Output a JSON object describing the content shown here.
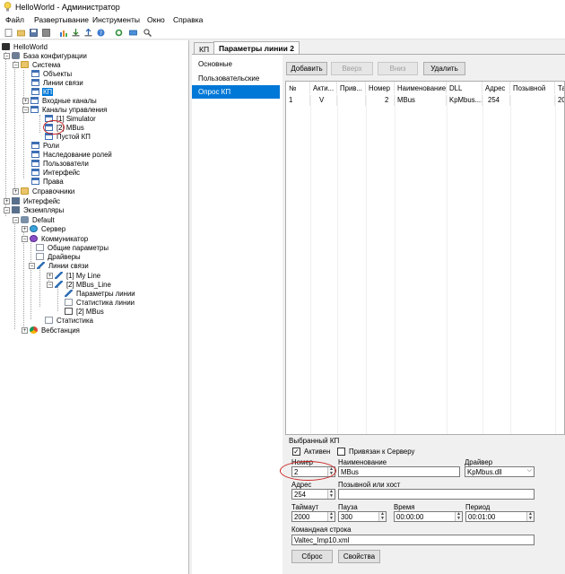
{
  "window": {
    "title": "HelloWorld - Администратор"
  },
  "menu": [
    "Файл",
    "Развертывание",
    "Инструменты",
    "Окно",
    "Справка"
  ],
  "toolbar": {
    "icons": [
      "new-icon",
      "open-icon",
      "save-icon",
      "save-all-icon",
      "charts-icon",
      "import-icon",
      "export-icon",
      "help-icon",
      "settings-icon",
      "deploy-icon",
      "search-icon"
    ]
  },
  "tree": {
    "nodes": [
      {
        "label": "HelloWorld",
        "icon": "project-icon"
      },
      {
        "label": "База конфигурации",
        "icon": "database-icon"
      },
      {
        "label": "Система",
        "icon": "folder-icon"
      },
      {
        "label": "Объекты",
        "icon": "table-icon"
      },
      {
        "label": "Линии связи",
        "icon": "table-icon"
      },
      {
        "label": "КП",
        "icon": "table-icon"
      },
      {
        "label": "Входные каналы",
        "icon": "table-icon"
      },
      {
        "label": "Каналы управления",
        "icon": "table-icon"
      },
      {
        "label": "[1] Simulator",
        "icon": "table-icon"
      },
      {
        "label": "[2] MBus",
        "icon": "table-icon"
      },
      {
        "label": "Пустой КП",
        "icon": "table-icon"
      },
      {
        "label": "Роли",
        "icon": "table-icon"
      },
      {
        "label": "Наследование ролей",
        "icon": "table-icon"
      },
      {
        "label": "Пользователи",
        "icon": "table-icon"
      },
      {
        "label": "Интерфейс",
        "icon": "table-icon"
      },
      {
        "label": "Права",
        "icon": "table-icon"
      },
      {
        "label": "Справочники",
        "icon": "folder-icon"
      },
      {
        "label": "Интерфейс",
        "icon": "interface-icon"
      },
      {
        "label": "Экземпляры",
        "icon": "instances-icon"
      },
      {
        "label": "Default",
        "icon": "instance-icon"
      },
      {
        "label": "Сервер",
        "icon": "server-icon"
      },
      {
        "label": "Коммуникатор",
        "icon": "communicator-icon"
      },
      {
        "label": "Общие параметры",
        "icon": "page-icon"
      },
      {
        "label": "Драйверы",
        "icon": "page-icon"
      },
      {
        "label": "Линии связи",
        "icon": "comm-lines-icon"
      },
      {
        "label": "[1] My Line",
        "icon": "line-icon"
      },
      {
        "label": "[2] MBus_Line",
        "icon": "line-icon"
      },
      {
        "label": "Параметры линии",
        "icon": "line-params-icon"
      },
      {
        "label": "Статистика линии",
        "icon": "page-icon"
      },
      {
        "label": "[2] MBus",
        "icon": "device-icon"
      },
      {
        "label": "Статистика",
        "icon": "page-icon"
      },
      {
        "label": "Вебстанция",
        "icon": "browser-icon"
      }
    ]
  },
  "tabs": [
    "КП",
    "Параметры линии 2"
  ],
  "nav": [
    "Основные",
    "Пользовательские",
    "Опрос КП"
  ],
  "buttons": {
    "add": "Добавить",
    "up": "Вверх",
    "down": "Вниз",
    "delete": "Удалить"
  },
  "grid": {
    "headers": [
      "№",
      "Акти...",
      "Прив...",
      "Номер",
      "Наименование",
      "DLL",
      "Адрес",
      "Позывной",
      "Тайм"
    ],
    "rows": [
      [
        "1",
        "V",
        "",
        "2",
        "MBus",
        "KpMbus....",
        "254",
        "",
        "20"
      ]
    ]
  },
  "selected": {
    "group_title": "Выбранный КП",
    "active_label": "Активен",
    "active_checked": "✓",
    "bind_label": "Привязан к Серверу",
    "number_label": "Номер",
    "number_value": "2",
    "name_label": "Наименование",
    "name_value": "MBus",
    "driver_label": "Драйвер",
    "driver_value": "KpMbus.dll",
    "address_label": "Адрес",
    "address_value": "254",
    "callnum_label": "Позывной или хост",
    "callnum_value": "",
    "timeout_label": "Таймаут",
    "timeout_value": "2000",
    "delay_label": "Пауза",
    "delay_value": "300",
    "time_label": "Время",
    "time_value": "00:00:00",
    "period_label": "Период",
    "period_value": "00:01:00",
    "cmdline_label": "Командная строка",
    "cmdline_value": "Valtec_Imp10.xml",
    "reset_button": "Сброс",
    "props_button": "Свойства"
  },
  "colors": {
    "accent": "#0078d7",
    "annotation": "#c8231f"
  }
}
